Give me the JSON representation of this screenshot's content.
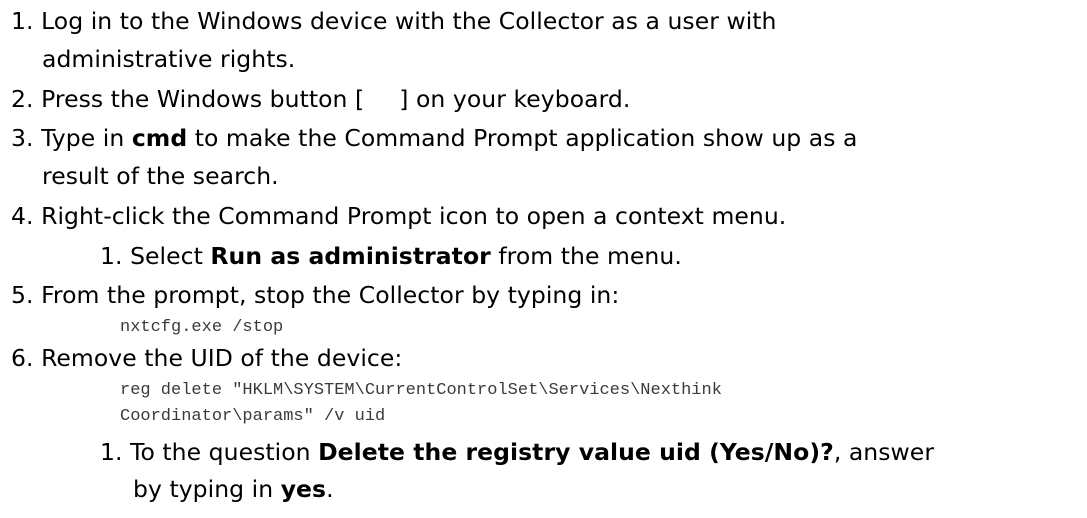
{
  "steps": [
    {
      "number": "1.",
      "line1": "Log in to the Windows device with the Collector as a user with",
      "line2": "administrative rights."
    },
    {
      "number": "2.",
      "text_before": "Press the Windows button [",
      "text_after": "] on your keyboard."
    },
    {
      "number": "3.",
      "text_before": "Type in ",
      "bold": "cmd",
      "text_after": " to make the Command Prompt application show up as a",
      "line2": "result of the search."
    },
    {
      "number": "4.",
      "text": "Right-click the Command Prompt icon to open a context menu.",
      "substep": {
        "number": "1.",
        "text_before": "Select ",
        "bold": "Run as administrator",
        "text_after": " from the menu."
      }
    },
    {
      "number": "5.",
      "text": "From the prompt, stop the Collector by typing in:",
      "code": "nxtcfg.exe /stop"
    },
    {
      "number": "6.",
      "text": "Remove the UID of the device:",
      "code_line1": "reg delete \"HKLM\\SYSTEM\\CurrentControlSet\\Services\\Nexthink",
      "code_line2": "Coordinator\\params\" /v uid",
      "substep": {
        "number": "1.",
        "text_before": "To the question ",
        "bold": "Delete the registry value uid (Yes/No)?",
        "text_after": ", answer",
        "line2_before": "by typing in ",
        "line2_bold": "yes",
        "line2_after": "."
      }
    }
  ]
}
